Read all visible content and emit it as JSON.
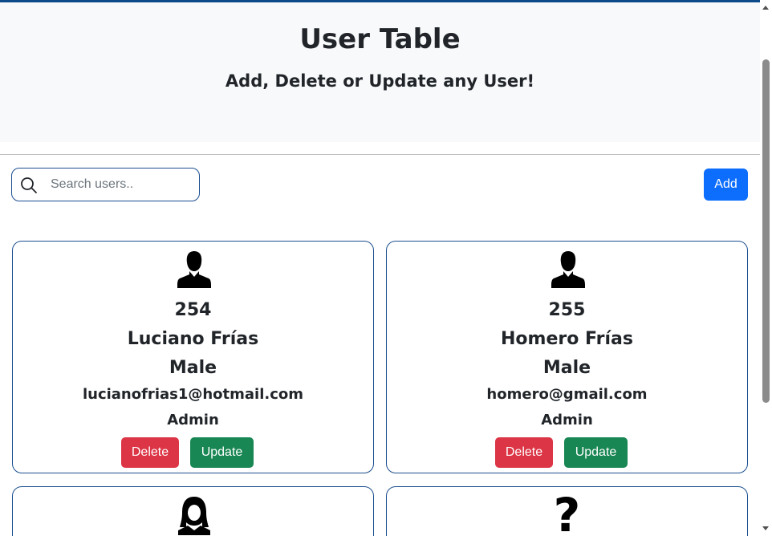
{
  "header": {
    "title": "User Table",
    "subtitle": "Add, Delete or Update any User!"
  },
  "search": {
    "placeholder": "Search users..",
    "value": "",
    "icon": "search-icon"
  },
  "toolbar": {
    "add_label": "Add"
  },
  "cards": [
    {
      "avatar": "male-user-icon",
      "id": "254",
      "name": "Luciano Frías",
      "gender": "Male",
      "email": "lucianofrias1@hotmail.com",
      "role": "Admin",
      "delete_label": "Delete",
      "update_label": "Update"
    },
    {
      "avatar": "male-user-icon",
      "id": "255",
      "name": "Homero Frías",
      "gender": "Male",
      "email": "homero@gmail.com",
      "role": "Admin",
      "delete_label": "Delete",
      "update_label": "Update"
    },
    {
      "avatar": "female-user-icon"
    },
    {
      "avatar": "question-mark-icon",
      "glyph": "?"
    }
  ],
  "colors": {
    "accent": "#0d6efd",
    "danger": "#dc3545",
    "success": "#198754",
    "card_border": "#1b4e8f",
    "header_bg": "#f8f9fa"
  }
}
